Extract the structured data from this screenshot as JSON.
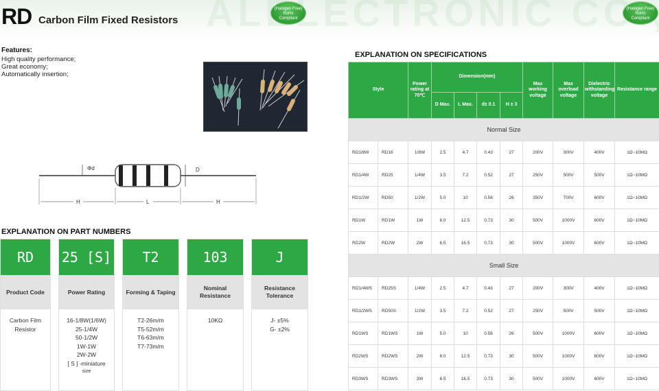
{
  "header": {
    "code": "RD",
    "title": "Carbon Film Fixed Resistors",
    "watermark": "ALELECTRONIC CO.,LT",
    "badge_lines": [
      "(Halogen Free)",
      "RoHs",
      "Compliant"
    ]
  },
  "features": {
    "title": "Features:",
    "items": [
      "High quality performance;",
      "Great economy;",
      "Automatically insertion;"
    ]
  },
  "drawing": {
    "diameter_label": "Φd",
    "body_label": "D",
    "lead_label": "H",
    "length_label": "L"
  },
  "part_numbers": {
    "title": "EXPLANATION ON PART NUMBERS",
    "cards": [
      {
        "code": "RD",
        "label": "Product Code",
        "desc": [
          "Carbon Film",
          "Resistor"
        ]
      },
      {
        "code": "25 [S]",
        "label": "Power Rating",
        "desc": [
          "16-1/8W(1/6W)",
          "25-1/4W",
          "50-1/2W",
          "1W-1W",
          "2W-2W",
          "[ S ] -miniature"
        ],
        "note": "size"
      },
      {
        "code": "T2",
        "label": "Forming & Taping",
        "desc": [
          "T2-26m/m",
          "T5-52m/m",
          "T6-63m/m",
          "T7-73m/m"
        ]
      },
      {
        "code": "103",
        "label": "Nominal Resistance",
        "desc": [
          "10KΩ"
        ]
      },
      {
        "code": "J",
        "label": "Resistance Tolerance",
        "desc": [
          "J-  ±5%",
          "G-  ±2%"
        ]
      }
    ]
  },
  "specs": {
    "title": "EXPLANATION ON SPECIFICATIONS",
    "headers": {
      "style": "Style",
      "power": "Power rating at 70℃",
      "dimension": "Dimension(mm)",
      "d_max": "D Max.",
      "l_max": "L Max.",
      "d_tol": "d± 0.1",
      "h_tol": "H ± 3",
      "max_working": "Max working voltage",
      "max_overload": "Max overload voltage",
      "dielectric": "Dielectric withstanding voltage",
      "resistance": "Resistance range"
    },
    "sections": [
      {
        "name": "Normal Size",
        "rows": [
          [
            "RD1/8W",
            "RD16",
            "1/8W",
            "2.5",
            "4.7",
            "0.43",
            "27",
            "200V",
            "300V",
            "400V",
            "1Ω~10MΩ"
          ],
          [
            "RD1/4W",
            "RD25",
            "1/4W",
            "3.5",
            "7.2",
            "0.52",
            "27",
            "250V",
            "500V",
            "500V",
            "1Ω~10MΩ"
          ],
          [
            "RD1/2W",
            "RD50",
            "1/2W",
            "5.0",
            "10",
            "0.56",
            "26",
            "350V",
            "700V",
            "600V",
            "1Ω~10MΩ"
          ],
          [
            "RD1W",
            "RD1W",
            "1W",
            "6.0",
            "12.5",
            "0.73",
            "30",
            "500V",
            "1000V",
            "600V",
            "1Ω~10MΩ"
          ],
          [
            "RD2W",
            "RD2W",
            "2W",
            "6.5",
            "16.5",
            "0.73",
            "30",
            "500V",
            "1000V",
            "600V",
            "1Ω~10MΩ"
          ]
        ]
      },
      {
        "name": "Small Size",
        "rows": [
          [
            "RD1/4WS",
            "RD25S",
            "1/4W",
            "2.5",
            "4.7",
            "0.43",
            "27",
            "200V",
            "300V",
            "400V",
            "1Ω~10MΩ"
          ],
          [
            "RD1/2WS",
            "RD50S",
            "1/2W",
            "3.5",
            "7.2",
            "0.52",
            "27",
            "250V",
            "500V",
            "500V",
            "1Ω~10MΩ"
          ],
          [
            "RD1WS",
            "RD1WS",
            "1W",
            "5.0",
            "10",
            "0.56",
            "26",
            "500V",
            "1000V",
            "600V",
            "1Ω~10MΩ"
          ],
          [
            "RD2WS",
            "RD2WS",
            "2W",
            "6.0",
            "12.5",
            "0.73",
            "30",
            "500V",
            "1000V",
            "600V",
            "1Ω~10MΩ"
          ],
          [
            "RD3WS",
            "RD3WS",
            "3W",
            "6.5",
            "16.5",
            "0.73",
            "30",
            "500V",
            "1000V",
            "600V",
            "1Ω~10MΩ"
          ]
        ]
      }
    ]
  },
  "colors": {
    "green": "#2ea845",
    "gray": "#e3e3e3"
  }
}
